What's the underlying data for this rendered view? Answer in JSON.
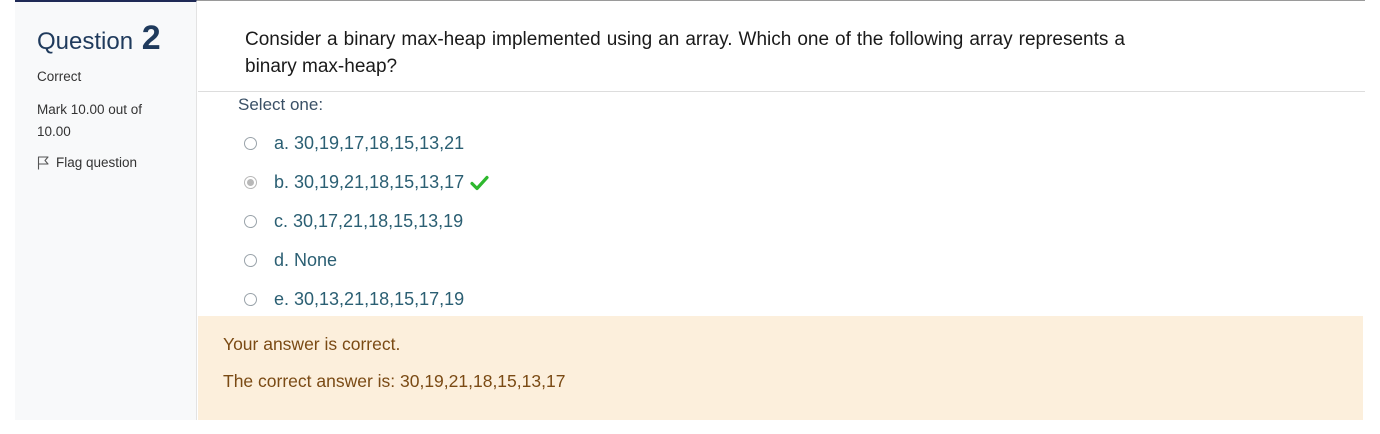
{
  "question": {
    "label": "Question",
    "number": "2",
    "state": "Correct",
    "grade": "Mark 10.00 out of 10.00",
    "flag_label": "Flag question",
    "text": "Consider a binary max-heap implemented using an array. Which one of the following array represents a binary max-heap?"
  },
  "answer": {
    "prompt": "Select one:",
    "options": [
      {
        "label": "a. 30,19,17,18,15,13,21",
        "checked": false
      },
      {
        "label": "b. 30,19,21,18,15,13,17",
        "checked": true
      },
      {
        "label": "c. 30,17,21,18,15,13,19",
        "checked": false
      },
      {
        "label": "d. None",
        "checked": false
      },
      {
        "label": "e. 30,13,21,18,15,17,19",
        "checked": false
      }
    ]
  },
  "feedback": {
    "message": "Your answer is correct.",
    "correct_answer": "The correct answer is: 30,19,21,18,15,13,17"
  },
  "colors": {
    "info_border": "#1f2a56",
    "feedback_bg": "#fcefdc",
    "check_green": "#2eb82e",
    "option_text": "#2b5f73"
  }
}
